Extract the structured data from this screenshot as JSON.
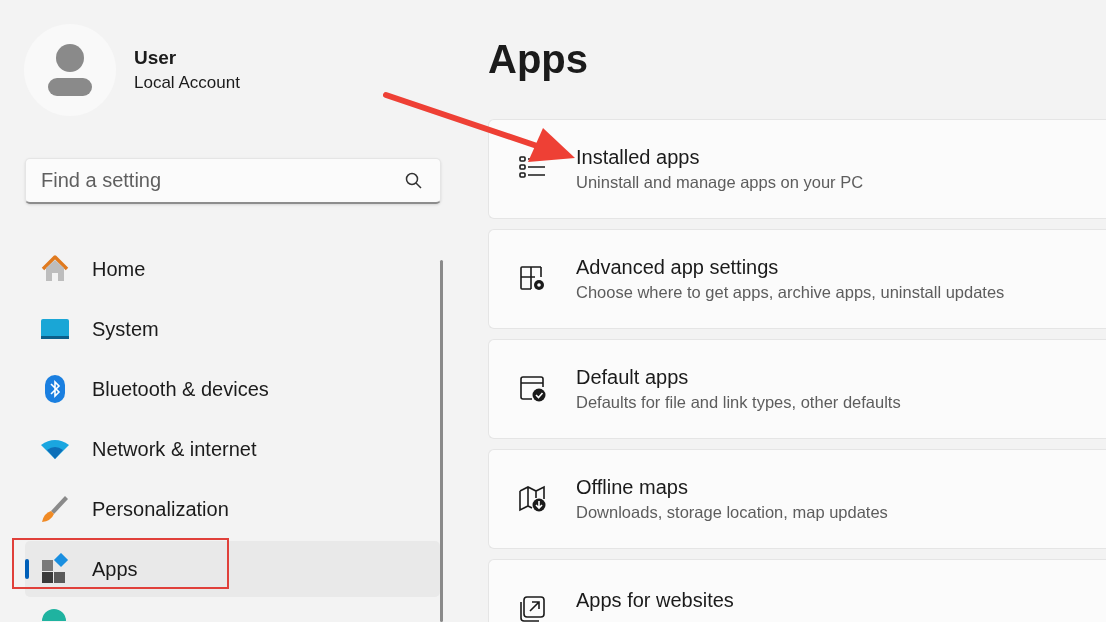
{
  "account": {
    "name": "User",
    "type": "Local Account"
  },
  "search": {
    "placeholder": "Find a setting"
  },
  "nav": [
    {
      "label": "Home",
      "selected": false
    },
    {
      "label": "System",
      "selected": false
    },
    {
      "label": "Bluetooth & devices",
      "selected": false
    },
    {
      "label": "Network & internet",
      "selected": false
    },
    {
      "label": "Personalization",
      "selected": false
    },
    {
      "label": "Apps",
      "selected": true
    }
  ],
  "page_title": "Apps",
  "cards": [
    {
      "title": "Installed apps",
      "description": "Uninstall and manage apps on your PC"
    },
    {
      "title": "Advanced app settings",
      "description": "Choose where to get apps, archive apps, uninstall updates"
    },
    {
      "title": "Default apps",
      "description": "Defaults for file and link types, other defaults"
    },
    {
      "title": "Offline maps",
      "description": "Downloads, storage location, map updates"
    },
    {
      "title": "Apps for websites"
    }
  ],
  "annotations": {
    "arrow": true,
    "highlight_box": true
  }
}
